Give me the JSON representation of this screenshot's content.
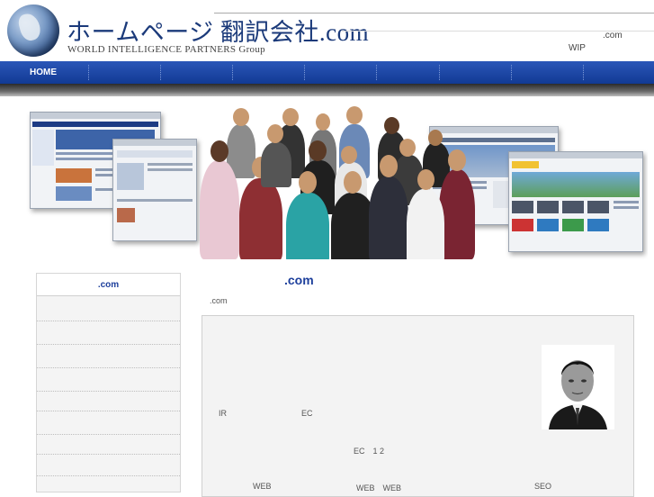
{
  "header": {
    "title": "ホームページ 翻訳会社.com",
    "subtitle": "WORLD INTELLIGENCE PARTNERS Group",
    "right_line1": ".com",
    "right_line2": "WIP"
  },
  "nav": {
    "items": [
      {
        "label": "HOME"
      }
    ],
    "accent": "#1a44a6"
  },
  "sidebar": {
    "heading": ".com"
  },
  "main": {
    "title": ".com",
    "subtitle": ".com",
    "text_ir": "IR",
    "text_ec": "EC",
    "text_ec12": "EC　1 2",
    "text_web1": "WEB",
    "text_web2": "WEB　WEB",
    "text_seo": "SEO"
  }
}
